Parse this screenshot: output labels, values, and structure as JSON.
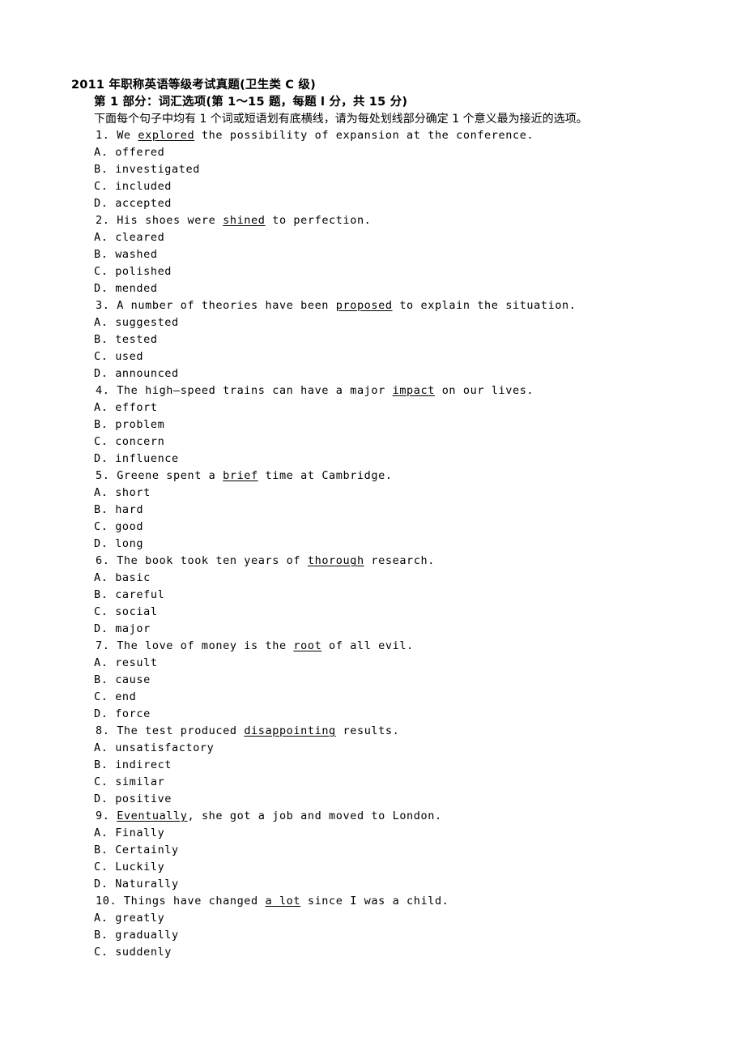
{
  "document": {
    "title": "2011 年职称英语等级考试真题(卫生类 C 级)",
    "section_title": "第 1 部分：词汇选项(第 1～15 题，每题 l 分，共 15 分)",
    "section_instruction": "下面每个句子中均有 1 个词或短语划有底横线，请为每处划线部分确定 1 个意义最为接近的选项。"
  },
  "questions": [
    {
      "number": "1.",
      "stem_before": "We ",
      "keyword": "explored",
      "stem_after": " the possibility of expansion at the conference.",
      "options": [
        {
          "label": "A.",
          "text": "offered"
        },
        {
          "label": "B.",
          "text": "investigated"
        },
        {
          "label": "C.",
          "text": "included"
        },
        {
          "label": "D.",
          "text": "accepted"
        }
      ]
    },
    {
      "number": "2.",
      "stem_before": "His shoes were ",
      "keyword": "shined",
      "stem_after": " to perfection.",
      "options": [
        {
          "label": "A.",
          "text": "cleared"
        },
        {
          "label": "B.",
          "text": "washed"
        },
        {
          "label": "C.",
          "text": "polished"
        },
        {
          "label": "D.",
          "text": "mended"
        }
      ]
    },
    {
      "number": "3.",
      "stem_before": "A number of theories have been ",
      "keyword": "proposed",
      "stem_after": " to explain the situation.",
      "options": [
        {
          "label": "A.",
          "text": "suggested"
        },
        {
          "label": "B.",
          "text": "tested"
        },
        {
          "label": "C.",
          "text": "used"
        },
        {
          "label": "D.",
          "text": "announced"
        }
      ]
    },
    {
      "number": "4.",
      "stem_before": "The high—speed trains can have a major ",
      "keyword": "impact",
      "stem_after": " on our lives.",
      "options": [
        {
          "label": "A.",
          "text": "effort"
        },
        {
          "label": "B.",
          "text": "problem"
        },
        {
          "label": "C.",
          "text": "concern"
        },
        {
          "label": "D.",
          "text": "influence"
        }
      ]
    },
    {
      "number": "5.",
      "stem_before": "Greene spent a ",
      "keyword": "brief",
      "stem_after": " time at Cambridge.",
      "options": [
        {
          "label": "A.",
          "text": "short"
        },
        {
          "label": "B.",
          "text": "hard"
        },
        {
          "label": "C.",
          "text": "good"
        },
        {
          "label": "D.",
          "text": "long"
        }
      ]
    },
    {
      "number": "6.",
      "stem_before": "The book took ten years of ",
      "keyword": "thorough",
      "stem_after": " research.",
      "options": [
        {
          "label": "A.",
          "text": "basic"
        },
        {
          "label": "B.",
          "text": "careful"
        },
        {
          "label": "C.",
          "text": "social"
        },
        {
          "label": "D.",
          "text": "major"
        }
      ]
    },
    {
      "number": "7.",
      "stem_before": "The love of money is the ",
      "keyword": "root",
      "stem_after": " of all evil.",
      "options": [
        {
          "label": "A.",
          "text": "result"
        },
        {
          "label": "B.",
          "text": "cause"
        },
        {
          "label": "C.",
          "text": "end"
        },
        {
          "label": "D.",
          "text": "force"
        }
      ]
    },
    {
      "number": "8.",
      "stem_before": "The test produced ",
      "keyword": "disappointing",
      "stem_after": " results.",
      "options": [
        {
          "label": "A.",
          "text": "unsatisfactory"
        },
        {
          "label": "B.",
          "text": "indirect"
        },
        {
          "label": "C.",
          "text": "similar"
        },
        {
          "label": "D.",
          "text": "positive"
        }
      ]
    },
    {
      "number": "9.",
      "stem_before": "",
      "keyword": "Eventually",
      "stem_after": ", she got a job and moved to London.",
      "options": [
        {
          "label": "A.",
          "text": "Finally"
        },
        {
          "label": "B.",
          "text": "Certainly"
        },
        {
          "label": "C.",
          "text": "Luckily"
        },
        {
          "label": "D.",
          "text": "Naturally"
        }
      ]
    },
    {
      "number": "10.",
      "stem_before": "Things have changed ",
      "keyword": "a lot",
      "stem_after": " since I was a child.",
      "options": [
        {
          "label": "A.",
          "text": "greatly"
        },
        {
          "label": "B.",
          "text": "gradually"
        },
        {
          "label": "C.",
          "text": "suddenly"
        }
      ]
    }
  ]
}
